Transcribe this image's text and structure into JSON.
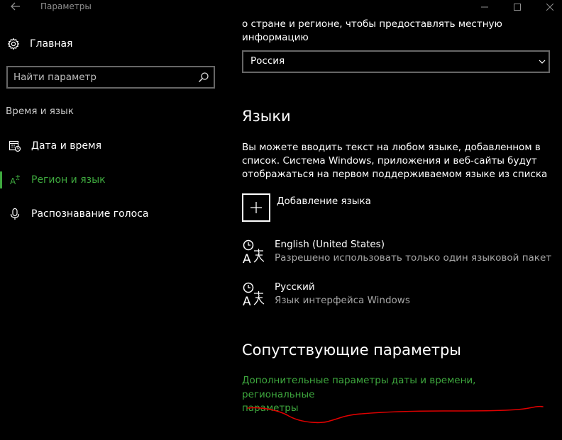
{
  "window": {
    "title": "Параметры"
  },
  "sidebar": {
    "home_label": "Главная",
    "search_placeholder": "Найти параметр",
    "group_label": "Время и язык",
    "items": [
      {
        "label": "Дата и время",
        "icon": "calendar-clock-icon"
      },
      {
        "label": "Регион и язык",
        "icon": "language-icon",
        "active": true
      },
      {
        "label": "Распознавание голоса",
        "icon": "microphone-icon"
      }
    ]
  },
  "region": {
    "text_line1": "о стране и регионе, чтобы предоставлять местную",
    "text_line2": "информацию",
    "selected_country": "Россия"
  },
  "languages": {
    "heading": "Языки",
    "description_line1": "Вы можете вводить текст на любом языке, добавленном в",
    "description_line2": "список. Система Windows, приложения и веб-сайты будут",
    "description_line3": "отображаться на первом поддерживаемом языке из списка",
    "add_label": "Добавление языка",
    "items": [
      {
        "name": "English (United States)",
        "description": "Разрешено использовать только один языковой пакет"
      },
      {
        "name": "Русский",
        "description": "Язык интерфейса Windows"
      }
    ]
  },
  "related": {
    "heading": "Сопутствующие параметры",
    "link_line1": "Дополнительные параметры даты и времени, региональные",
    "link_line2": "параметры"
  },
  "colors": {
    "accent": "#3ea83e",
    "background": "#000000",
    "annotation": "#e00000"
  }
}
